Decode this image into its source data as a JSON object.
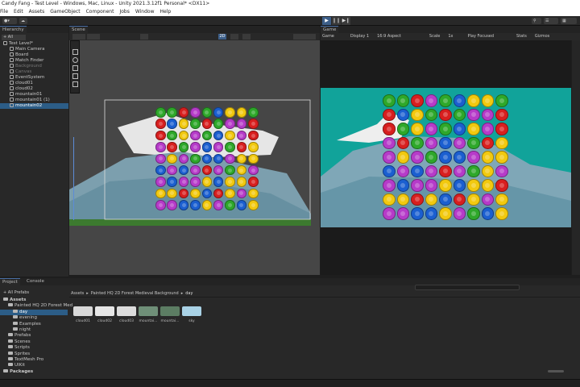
{
  "window": {
    "title": "Candy Fang - Test Level - Windows, Mac, Linux - Unity 2021.3.12f1 Personal* <DX11>"
  },
  "menu": [
    "File",
    "Edit",
    "Assets",
    "GameObject",
    "Component",
    "Jobs",
    "Window",
    "Help"
  ],
  "hierarchy": {
    "tab": "Hierarchy",
    "search_label": "All",
    "items": [
      {
        "label": "Test Level*",
        "state": "scene"
      },
      {
        "label": "Main Camera",
        "state": "normal"
      },
      {
        "label": "Board",
        "state": "normal"
      },
      {
        "label": "Match Finder",
        "state": "normal"
      },
      {
        "label": "Background",
        "state": "dim"
      },
      {
        "label": "Canvas",
        "state": "dim"
      },
      {
        "label": "EventSystem",
        "state": "normal"
      },
      {
        "label": "cloud01",
        "state": "normal"
      },
      {
        "label": "cloud02",
        "state": "normal"
      },
      {
        "label": "mountain01",
        "state": "normal"
      },
      {
        "label": "mountain01 (1)",
        "state": "normal"
      },
      {
        "label": "mountain02",
        "state": "selected"
      }
    ]
  },
  "scene": {
    "tab": "Scene",
    "mode_2d": "2D"
  },
  "game": {
    "tab": "Game",
    "mode": "Game",
    "display": "Display 1",
    "aspect": "16:9 Aspect",
    "scale_label": "Scale",
    "scale_value": "1x",
    "play_focused": "Play Focused",
    "stats": "Stats",
    "gizmos": "Gizmos",
    "sky_color": "#11a39a"
  },
  "board": {
    "rows": [
      [
        "green",
        "green",
        "red",
        "purple",
        "green",
        "blue",
        "yellow",
        "yellow",
        "green"
      ],
      [
        "red",
        "blue",
        "yellow",
        "green",
        "red",
        "green",
        "purple",
        "purple",
        "red"
      ],
      [
        "red",
        "green",
        "yellow",
        "purple",
        "green",
        "blue",
        "yellow",
        "purple",
        "red"
      ],
      [
        "purple",
        "red",
        "green",
        "purple",
        "blue",
        "purple",
        "green",
        "red",
        "yellow"
      ],
      [
        "purple",
        "yellow",
        "purple",
        "green",
        "blue",
        "blue",
        "purple",
        "yellow",
        "yellow"
      ],
      [
        "blue",
        "purple",
        "blue",
        "purple",
        "red",
        "purple",
        "green",
        "yellow",
        "purple"
      ],
      [
        "purple",
        "blue",
        "purple",
        "purple",
        "yellow",
        "blue",
        "yellow",
        "yellow",
        "red"
      ],
      [
        "yellow",
        "yellow",
        "red",
        "yellow",
        "blue",
        "red",
        "yellow",
        "purple",
        "yellow"
      ],
      [
        "purple",
        "purple",
        "blue",
        "blue",
        "yellow",
        "purple",
        "green",
        "blue",
        "yellow"
      ]
    ],
    "colors": {
      "green": "#2ea82a",
      "red": "#d81f1f",
      "purple": "#b63bc9",
      "blue": "#1b5fd0",
      "yellow": "#f2c90f"
    }
  },
  "project": {
    "tabs": [
      "Project",
      "Console"
    ],
    "search_label": "All Prefabs",
    "breadcrumb": [
      "Assets",
      "Painted HQ 2D Forest Medieval Background",
      "day"
    ],
    "tree": [
      {
        "label": "Assets",
        "state": "header"
      },
      {
        "label": "Painted HQ 2D Forest Med",
        "state": "normal"
      },
      {
        "label": "day",
        "state": "selected"
      },
      {
        "label": "evening",
        "state": "normal"
      },
      {
        "label": "Examples",
        "state": "normal"
      },
      {
        "label": "night",
        "state": "normal"
      },
      {
        "label": "Prefabs",
        "state": "normal"
      },
      {
        "label": "Scenes",
        "state": "normal"
      },
      {
        "label": "Scripts",
        "state": "normal"
      },
      {
        "label": "Sprites",
        "state": "normal"
      },
      {
        "label": "TextMesh Pro",
        "state": "normal"
      },
      {
        "label": "UIKit",
        "state": "normal"
      },
      {
        "label": "Packages",
        "state": "header"
      }
    ],
    "assets": [
      {
        "label": "cloud01",
        "color": "#d8d8d8"
      },
      {
        "label": "cloud02",
        "color": "#e6e6e6"
      },
      {
        "label": "cloud03",
        "color": "#dcdcdc"
      },
      {
        "label": "mountai...",
        "color": "#6f8f78"
      },
      {
        "label": "mountai...",
        "color": "#5c7d63"
      },
      {
        "label": "sky",
        "color": "#a9d2e6"
      }
    ]
  }
}
